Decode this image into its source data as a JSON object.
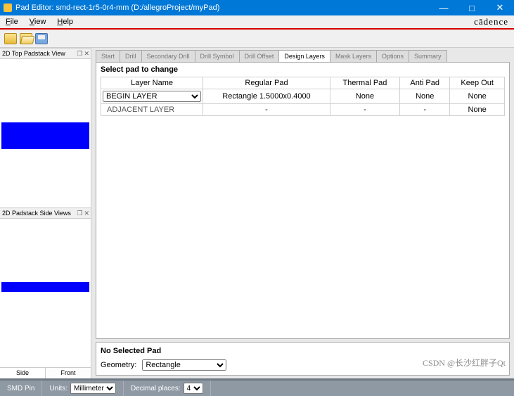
{
  "window": {
    "title": "Pad Editor: smd-rect-1r5-0r4-mm  (D:/allegroProject/myPad)",
    "minimize": "—",
    "maximize": "□",
    "close": "✕"
  },
  "menubar": {
    "file": "File",
    "view": "View",
    "help": "Help",
    "brand": "cādence"
  },
  "panels": {
    "top": "2D Top Padstack View",
    "side": "2D Padstack Side Views",
    "side_tab1": "Side",
    "side_tab2": "Front",
    "dock": "❐",
    "close": "✕"
  },
  "tabs": {
    "start": "Start",
    "drill": "Drill",
    "secdrill": "Secondary Drill",
    "drillsym": "Drill Symbol",
    "drilloff": "Drill Offset",
    "design": "Design Layers",
    "mask": "Mask Layers",
    "options": "Options",
    "summary": "Summary"
  },
  "content": {
    "heading": "Select pad to change",
    "table": {
      "headers": {
        "layer": "Layer Name",
        "regular": "Regular Pad",
        "thermal": "Thermal Pad",
        "anti": "Anti Pad",
        "keep": "Keep Out"
      },
      "rows": [
        {
          "layer": "BEGIN LAYER",
          "regular": "Rectangle 1.5000x0.4000",
          "thermal": "None",
          "anti": "None",
          "keep": "None",
          "select": true
        },
        {
          "layer": "ADJACENT LAYER",
          "regular": "-",
          "thermal": "-",
          "anti": "-",
          "keep": "None",
          "select": false
        }
      ]
    }
  },
  "bottom": {
    "heading": "No Selected Pad",
    "geometry_label": "Geometry:",
    "geometry_value": "Rectangle"
  },
  "status": {
    "type": "SMD Pin",
    "units_label": "Units:",
    "units_value": "Millimeter",
    "dec_label": "Decimal places:",
    "dec_value": "4"
  },
  "watermark": "CSDN @长沙红胖子Qt"
}
